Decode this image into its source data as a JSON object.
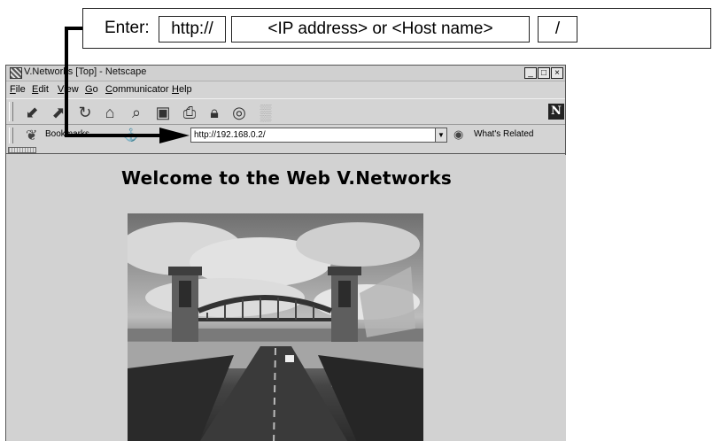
{
  "callout": {
    "enter_label": "Enter:",
    "protocol": "http://",
    "host": "<IP address> or <Host name>",
    "slash": "/"
  },
  "window": {
    "title": "V.Networks [Top] - Netscape",
    "controls": {
      "minimize": "_",
      "maximize": "□",
      "close": "×"
    }
  },
  "menubar": {
    "items": [
      "File",
      "Edit",
      "View",
      "Go",
      "Communicator",
      "Help"
    ]
  },
  "toolbar": {
    "buttons": [
      "back-icon",
      "forward-icon",
      "reload-icon",
      "home-icon",
      "search-icon",
      "my-netscape-icon",
      "print-icon",
      "security-icon",
      "shop-icon",
      "stop-icon"
    ],
    "brand": "N"
  },
  "location_bar": {
    "bookmarks_label": "Bookmarks",
    "url": "http://192.168.0.2/",
    "whats_related_label": "What's Related"
  },
  "page": {
    "heading": "Welcome to the Web V.Networks"
  }
}
